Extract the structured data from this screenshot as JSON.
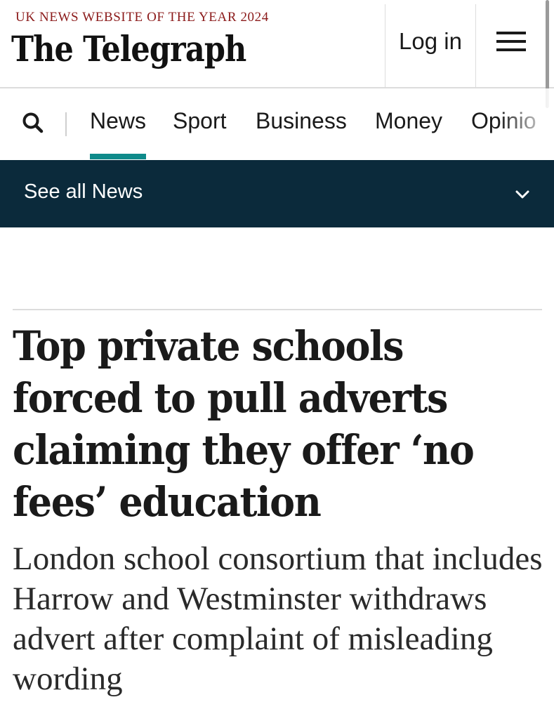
{
  "header": {
    "tagline": "UK NEWS WEBSITE OF THE YEAR 2024",
    "logo": "The Telegraph",
    "login_label": "Log in",
    "menu_icon": "hamburger-menu-icon"
  },
  "nav": {
    "search_icon": "search-icon",
    "items": [
      {
        "label": "News",
        "active": true
      },
      {
        "label": "Sport",
        "active": false
      },
      {
        "label": "Business",
        "active": false
      },
      {
        "label": "Money",
        "active": false
      },
      {
        "label": "Opinio",
        "active": false
      }
    ]
  },
  "section_bar": {
    "label": "See all News",
    "icon": "chevron-down-icon"
  },
  "article": {
    "headline": "Top private schools forced to pull adverts claiming they offer ‘no fees’ education",
    "standfirst": "London school consortium that includes Harrow and Westminster withdraws advert after complaint of misleading wording"
  },
  "colors": {
    "tagline": "#8b1a1a",
    "nav_active_underline": "#0e8a8a",
    "section_bar_background": "#0b2a3b",
    "text": "#1a1a1a"
  }
}
